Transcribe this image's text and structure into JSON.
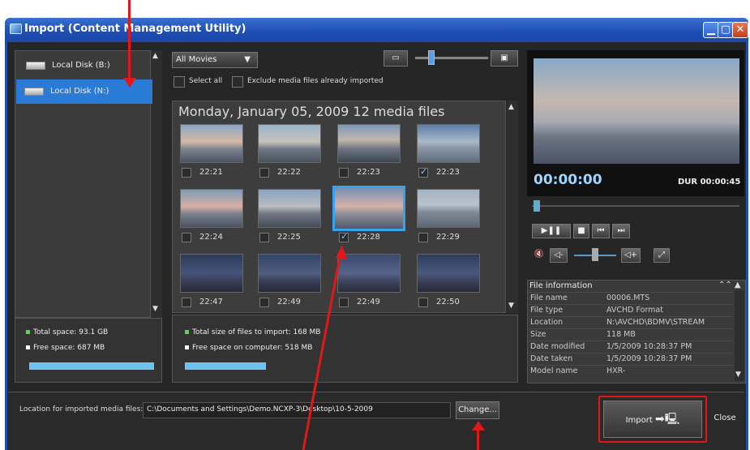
{
  "window": {
    "title": "Import (Content Management Utility)",
    "controls": {
      "minimize": "▁",
      "maximize": "▢",
      "close": "✕"
    }
  },
  "sources": {
    "items": [
      {
        "label": "Local Disk (B:)",
        "selected": false
      },
      {
        "label": "Local Disk (N:)",
        "selected": true
      }
    ],
    "total_space": "Total space: 93.1 GB",
    "free_space": "Free space: 687 MB"
  },
  "filter": {
    "dropdown_value": "All Movies",
    "select_all": "Select all",
    "exclude": "Exclude media files already imported"
  },
  "grid": {
    "header": "Monday, January 05, 2009 12 media files",
    "items": [
      {
        "time": "22:21",
        "checked": false
      },
      {
        "time": "22:22",
        "checked": false
      },
      {
        "time": "22:23",
        "checked": false
      },
      {
        "time": "22:23",
        "checked": true
      },
      {
        "time": "22:24",
        "checked": false
      },
      {
        "time": "22:25",
        "checked": false
      },
      {
        "time": "22:28",
        "checked": true
      },
      {
        "time": "22:29",
        "checked": false
      },
      {
        "time": "22:47",
        "checked": false
      },
      {
        "time": "22:49",
        "checked": false
      },
      {
        "time": "22:49",
        "checked": false
      },
      {
        "time": "22:50",
        "checked": false
      }
    ]
  },
  "import_summary": {
    "total_size": "Total size of files to import: 168 MB",
    "free_space": "Free space on computer: 518 MB"
  },
  "preview": {
    "timecode": "00:00:00",
    "duration": "DUR 00:00:45"
  },
  "file_info": {
    "header": "File information",
    "rows": [
      {
        "k": "File name",
        "v": "00006.MTS"
      },
      {
        "k": "File type",
        "v": "AVCHD Format"
      },
      {
        "k": "Location",
        "v": "N:\\AVCHD\\BDMV\\STREAM"
      },
      {
        "k": "Size",
        "v": "118 MB"
      },
      {
        "k": "Date modified",
        "v": "1/5/2009 10:28:37 PM"
      },
      {
        "k": "Date taken",
        "v": "1/5/2009 10:28:37 PM"
      },
      {
        "k": "Model name",
        "v": "HXR-"
      }
    ]
  },
  "location": {
    "label": "Location for imported media files:",
    "path": "C:\\Documents and Settings\\Demo.NCXP-3\\Desktop\\10-5-2009",
    "change_button": "Change..."
  },
  "actions": {
    "import_button": "Import",
    "close_button": "Close"
  },
  "colors": {
    "title_blue": "#1f4fb4",
    "selection_blue": "#2a7bd6",
    "annotation_red": "#e01818",
    "progress": "#6cc3ee"
  }
}
